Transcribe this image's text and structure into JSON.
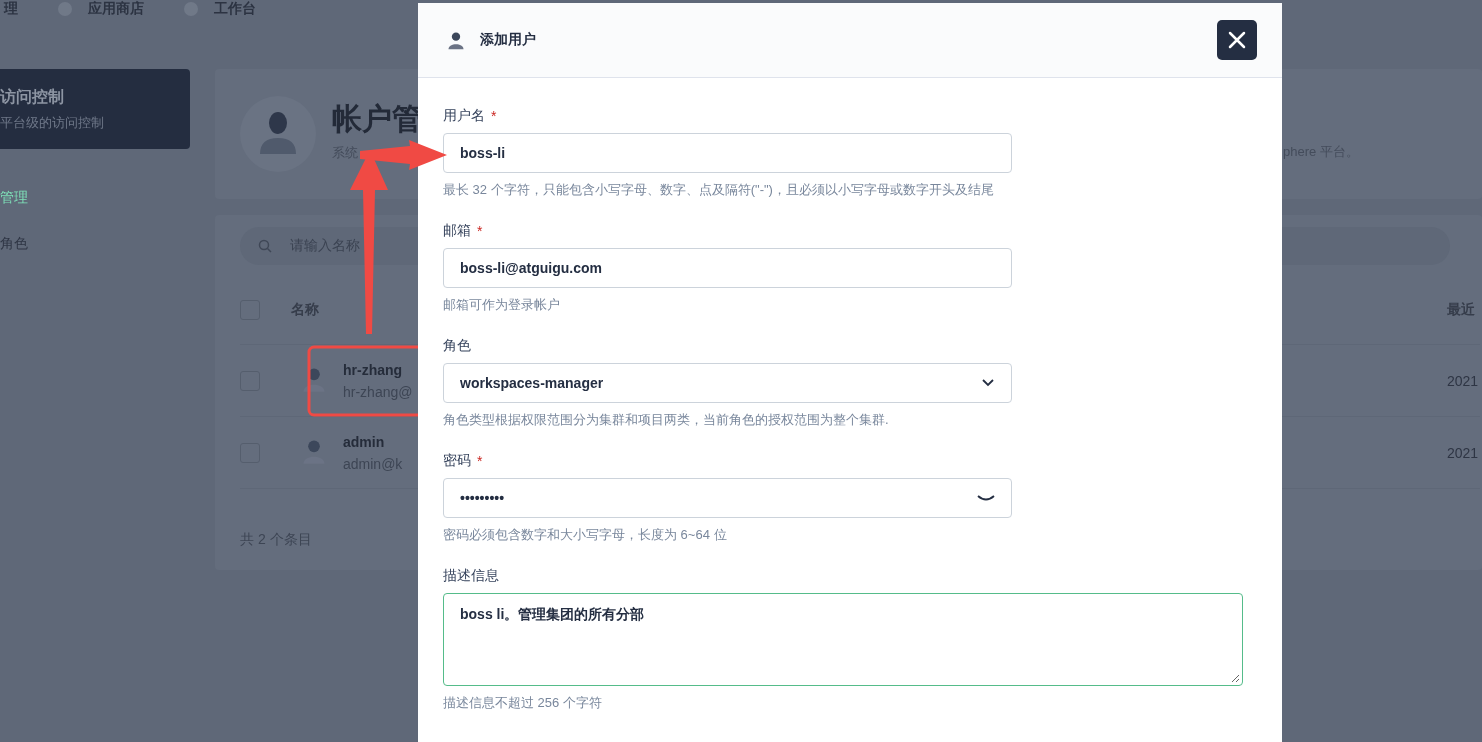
{
  "top_nav": [
    {
      "label": "理"
    },
    {
      "label": "应用商店"
    },
    {
      "label": "工作台"
    }
  ],
  "sidebar": {
    "title": "访问控制",
    "subtitle": "平台级的访问控制",
    "items": [
      {
        "label": "管理",
        "selected": true
      },
      {
        "label": "角色",
        "selected": false
      }
    ]
  },
  "page_header": {
    "title": "帐户管",
    "description": "系统",
    "description_tail": "phere 平台。"
  },
  "users_table": {
    "search": {
      "placeholder": "请输入名称"
    },
    "header_checked": false,
    "columns": [
      "名称",
      "最近"
    ],
    "rows": [
      {
        "name": "hr-zhang",
        "email": "hr-zhang@",
        "last_login": "2021",
        "checked": false
      },
      {
        "name": "admin",
        "email": "admin@k",
        "last_login": "2021",
        "checked": false
      }
    ],
    "total": "共 2 个条目"
  },
  "dialog": {
    "title": "添加用户",
    "fields": [
      {
        "kind": "text",
        "label": "用户名",
        "required_mark": "*",
        "value": "boss-li",
        "hint": "最长 32 个字符，只能包含小写字母、数字、点及隔符(\"-\")，且必须以小写字母或数字开头及结尾",
        "focused": false
      },
      {
        "kind": "text",
        "label": "邮箱",
        "required_mark": "*",
        "value": "boss-li@atguigu.com",
        "hint": "邮箱可作为登录帐户",
        "focused": false
      },
      {
        "kind": "select",
        "label": "角色",
        "value": "workspaces-manager",
        "hint": "角色类型根据权限范围分为集群和项目两类，当前角色的授权范围为整个集群.",
        "focused": false
      },
      {
        "kind": "password",
        "label": "密码",
        "required_mark": "*",
        "value": "•••••••••",
        "hint": "密码必须包含数字和大小写字母，长度为 6~64 位",
        "focused": false
      },
      {
        "kind": "textarea",
        "label": "描述信息",
        "value": "boss li。管理集团的所有分部",
        "hint": "描述信息不超过 256 个字符",
        "focused": true
      }
    ]
  }
}
